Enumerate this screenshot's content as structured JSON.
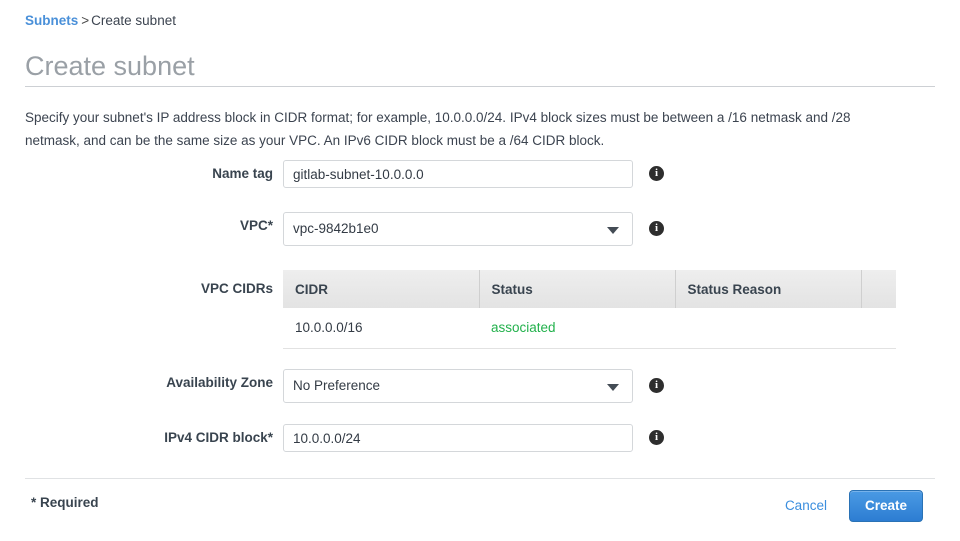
{
  "breadcrumb": {
    "link_label": "Subnets",
    "separator": ">",
    "current_label": "Create subnet"
  },
  "page": {
    "title": "Create subnet",
    "intro": "Specify your subnet's IP address block in CIDR format; for example, 10.0.0.0/24. IPv4 block sizes must be between a /16 netmask and /28 netmask, and can be the same size as your VPC. An IPv6 CIDR block must be a /64 CIDR block."
  },
  "form": {
    "name_tag": {
      "label": "Name tag",
      "value": "gitlab-subnet-10.0.0.0",
      "placeholder": "",
      "info_icon": "info-icon"
    },
    "vpc": {
      "label": "VPC*",
      "value": "vpc-9842b1e0",
      "caret_icon": "chevron-down-icon",
      "info_icon": "info-icon"
    },
    "vpc_cidrs": {
      "label": "VPC CIDRs",
      "columns": [
        "CIDR",
        "Status",
        "Status Reason",
        ""
      ],
      "rows": [
        {
          "cidr": "10.0.0.0/16",
          "status": "associated",
          "status_reason": "",
          "extra": ""
        }
      ],
      "status_color": "#22b14c"
    },
    "availability_zone": {
      "label": "Availability Zone",
      "value": "No Preference",
      "caret_icon": "chevron-down-icon",
      "info_icon": "info-icon"
    },
    "ipv4_cidr_block": {
      "label": "IPv4 CIDR block*",
      "value": "10.0.0.0/24",
      "placeholder": "",
      "info_icon": "info-icon"
    }
  },
  "footer": {
    "required_note": "* Required",
    "cancel_label": "Cancel",
    "create_label": "Create",
    "create_color": "#2d7dd2"
  }
}
